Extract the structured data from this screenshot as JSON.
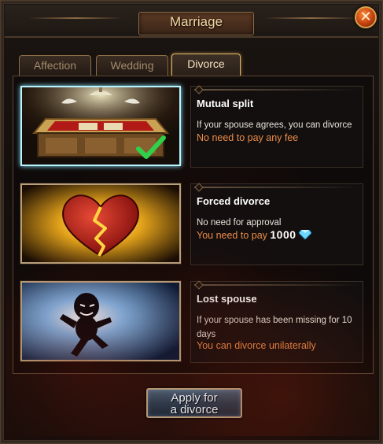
{
  "window": {
    "title": "Marriage",
    "close_label": "✕"
  },
  "tabs": [
    {
      "label": "Affection",
      "active": false
    },
    {
      "label": "Wedding",
      "active": false
    },
    {
      "label": "Divorce",
      "active": true
    }
  ],
  "options": [
    {
      "title": "Mutual split",
      "description": "If your spouse agrees, you can divorce",
      "note": "No need to pay any fee",
      "selected": true,
      "icon": "treasure-table-icon"
    },
    {
      "title": "Forced divorce",
      "description": "No need for approval",
      "note_prefix": "You need to pay",
      "price": "1000",
      "currency_icon": "diamond-icon",
      "selected": false,
      "icon": "broken-heart-icon"
    },
    {
      "title": "Lost spouse",
      "description": "If your spouse has been missing for 10 days",
      "note": "You can divorce unilaterally",
      "selected": false,
      "icon": "running-shadow-icon"
    }
  ],
  "apply_button": {
    "line1": "Apply for",
    "line2": "a divorce"
  },
  "colors": {
    "accent_orange": "#ec8c49",
    "selected_border": "#b8f3ff",
    "title_gold": "#f2d6a2",
    "checkmark": "#2fd14a"
  }
}
